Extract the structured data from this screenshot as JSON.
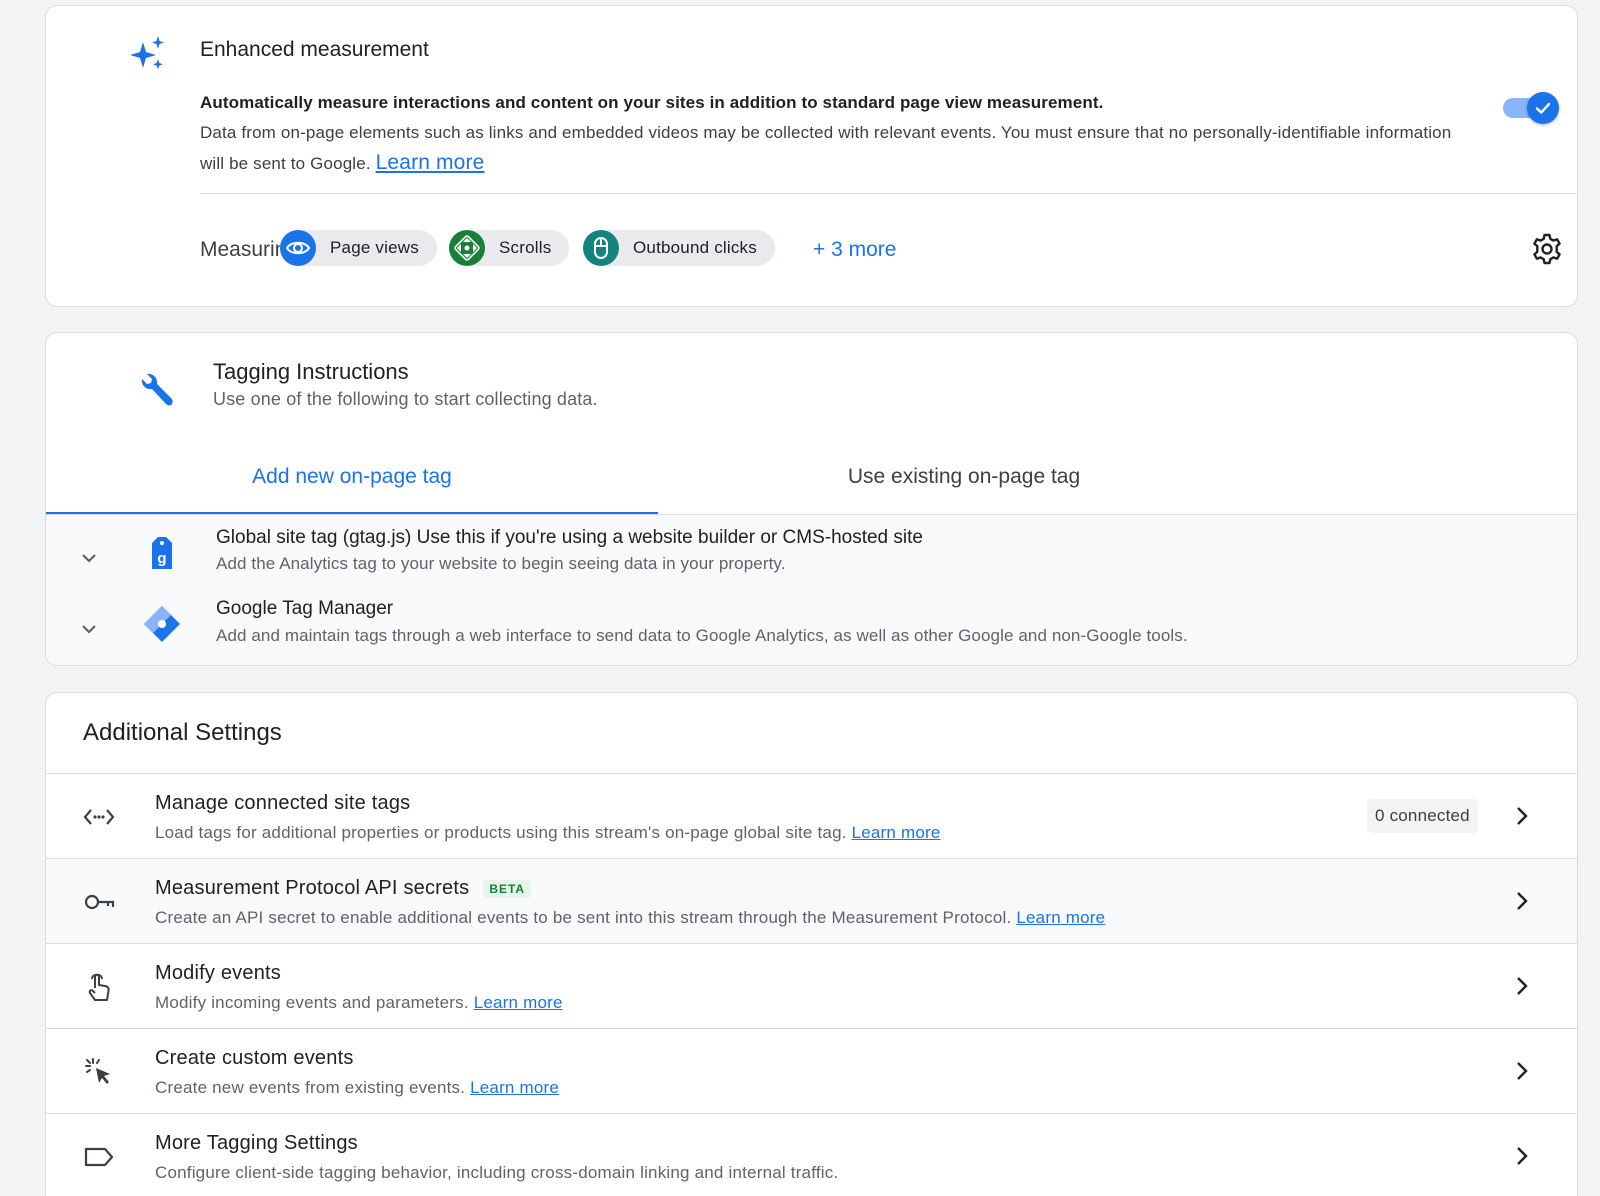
{
  "enhanced_measurement": {
    "title": "Enhanced measurement",
    "desc_bold": "Automatically measure interactions and content on your sites in addition to standard page view measurement.",
    "desc": "Data from on-page elements such as links and embedded videos may be collected with relevant events. You must ensure that no personally-identifiable information will be sent to Google.",
    "learn_more": "Learn more",
    "toggle_on": true,
    "measuring_label": "Measuring:",
    "chips": [
      {
        "label": "Page views",
        "icon": "eye-icon",
        "color": "#1a73e8"
      },
      {
        "label": "Scrolls",
        "icon": "scroll-arrows-icon",
        "color": "#188038"
      },
      {
        "label": "Outbound clicks",
        "icon": "mouse-icon",
        "color": "#12847a"
      }
    ],
    "more": "+ 3 more",
    "settings_icon": "gear-icon"
  },
  "tagging": {
    "title": "Tagging Instructions",
    "subtitle": "Use one of the following to start collecting data.",
    "tabs": [
      {
        "label": "Add new on-page tag",
        "active": true
      },
      {
        "label": "Use existing on-page tag",
        "active": false
      }
    ],
    "options": [
      {
        "title_bold": "Global site tag (gtag.js)",
        "title_rest": " Use this if you're using a website builder or CMS-hosted site",
        "subtitle": "Add the Analytics tag to your website to begin seeing data in your property.",
        "icon": "gtag-icon"
      },
      {
        "title_bold": "Google Tag Manager",
        "title_rest": "",
        "subtitle": "Add and maintain tags through a web interface to send data to Google Analytics, as well as other Google and non-Google tools.",
        "icon": "gtm-diamond-icon"
      }
    ]
  },
  "additional": {
    "title": "Additional Settings",
    "rows": [
      {
        "title": "Manage connected site tags",
        "subtitle": "Load tags for additional properties or products using this stream's on-page global site tag.",
        "link": "Learn more",
        "badge": "",
        "status": "0 connected",
        "icon": "code-icon"
      },
      {
        "title": "Measurement Protocol API secrets",
        "subtitle": "Create an API secret to enable additional events to be sent into this stream through the Measurement Protocol.",
        "link": "Learn more",
        "badge": "BETA",
        "status": "",
        "icon": "key-icon"
      },
      {
        "title": "Modify events",
        "subtitle": "Modify incoming events and parameters.",
        "link": "Learn more",
        "badge": "",
        "status": "",
        "icon": "touch-icon"
      },
      {
        "title": "Create custom events",
        "subtitle": "Create new events from existing events.",
        "link": "Learn more",
        "badge": "",
        "status": "",
        "icon": "cursor-click-icon"
      },
      {
        "title": "More Tagging Settings",
        "subtitle": "Configure client-side tagging behavior, including cross-domain linking and internal traffic.",
        "link": "",
        "badge": "",
        "status": "",
        "icon": "label-icon"
      }
    ]
  }
}
